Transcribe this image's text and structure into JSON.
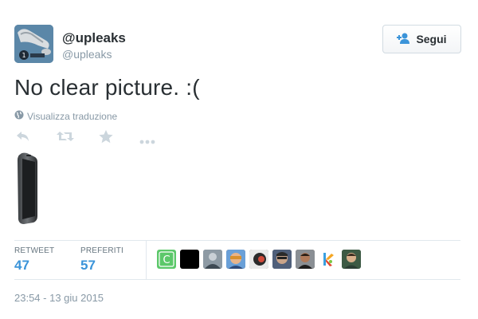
{
  "tweet": {
    "display_name": "@upleaks",
    "handle": "@upleaks",
    "text": "No clear picture. :(",
    "translate_label": "Visualizza traduzione",
    "timestamp": "23:54 - 13 giu 2015"
  },
  "follow_button": {
    "label": "Segui",
    "icon": "add-person-icon"
  },
  "actions": [
    {
      "name": "reply",
      "icon": "reply-icon"
    },
    {
      "name": "retweet",
      "icon": "retweet-icon"
    },
    {
      "name": "favorite",
      "icon": "star-icon"
    },
    {
      "name": "more",
      "icon": "more-icon"
    }
  ],
  "stats": {
    "retweet_label": "RETWEET",
    "retweet_count": "47",
    "favorites_label": "PREFERITI",
    "favorites_count": "57"
  },
  "favoriters": [
    {
      "letter": "C",
      "color": "#5cc86a"
    },
    {
      "color": "#000000"
    },
    {
      "color": "#7d8a94"
    },
    {
      "color": "#c77a3a"
    },
    {
      "color": "#4a4a4a"
    },
    {
      "color": "#5a5f66"
    },
    {
      "color": "#6b4e3c"
    },
    {
      "color": "#e2472f"
    },
    {
      "color": "#3f6b4a"
    }
  ],
  "colors": {
    "link": "#3b94d9",
    "muted": "#8899a6",
    "text": "#292f33"
  }
}
